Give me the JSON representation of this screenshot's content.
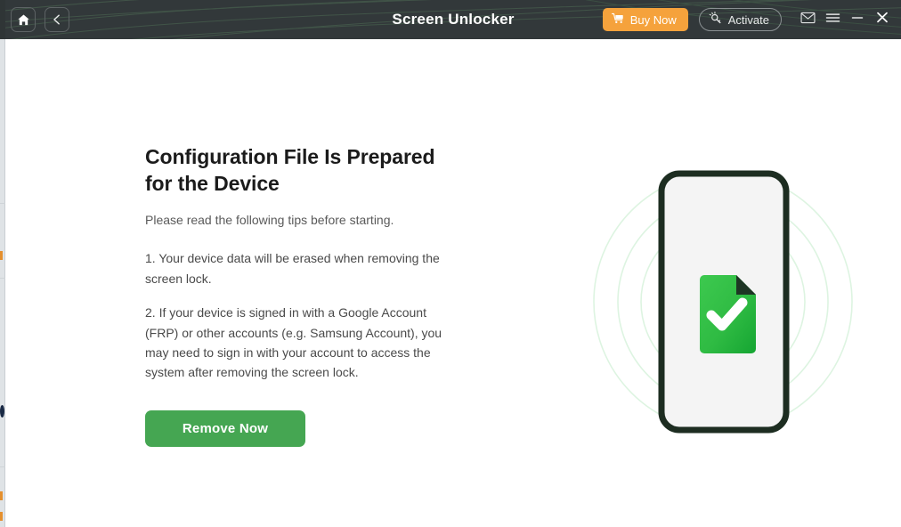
{
  "window": {
    "title": "Screen Unlocker",
    "titlebar": {
      "home_icon": "home-icon",
      "back_icon": "chevron-left-icon",
      "buy_label": "Buy Now",
      "buy_icon": "shopping-cart-icon",
      "buy_color": "#f5a23c",
      "activate_label": "Activate",
      "activate_icon": "activation-key-icon",
      "mail_icon": "envelope-icon",
      "menu_icon": "hamburger-menu-icon",
      "minimize_icon": "minimize-icon",
      "close_icon": "close-icon",
      "background_color": "#32383a"
    }
  },
  "main": {
    "headline": "Configuration File Is Prepared for the Device",
    "subhead": "Please read the following tips before starting.",
    "tips": [
      "1. Your device data will be erased when removing the screen lock.",
      "2. If your device is signed in with a Google Account (FRP) or other accounts (e.g. Samsung Account), you may need to sign in with your account to access the system after removing the screen lock."
    ],
    "primary_button": {
      "label": "Remove Now",
      "color": "#45a652"
    },
    "illustration": {
      "name": "phone-with-configuration-file-icon",
      "phone_frame_color": "#1d2d21",
      "phone_screen_color": "#f4f4f4",
      "file_icon_color": "#2bb742",
      "ring_color": "#d8f3dd",
      "check_color": "#ffffff"
    }
  }
}
